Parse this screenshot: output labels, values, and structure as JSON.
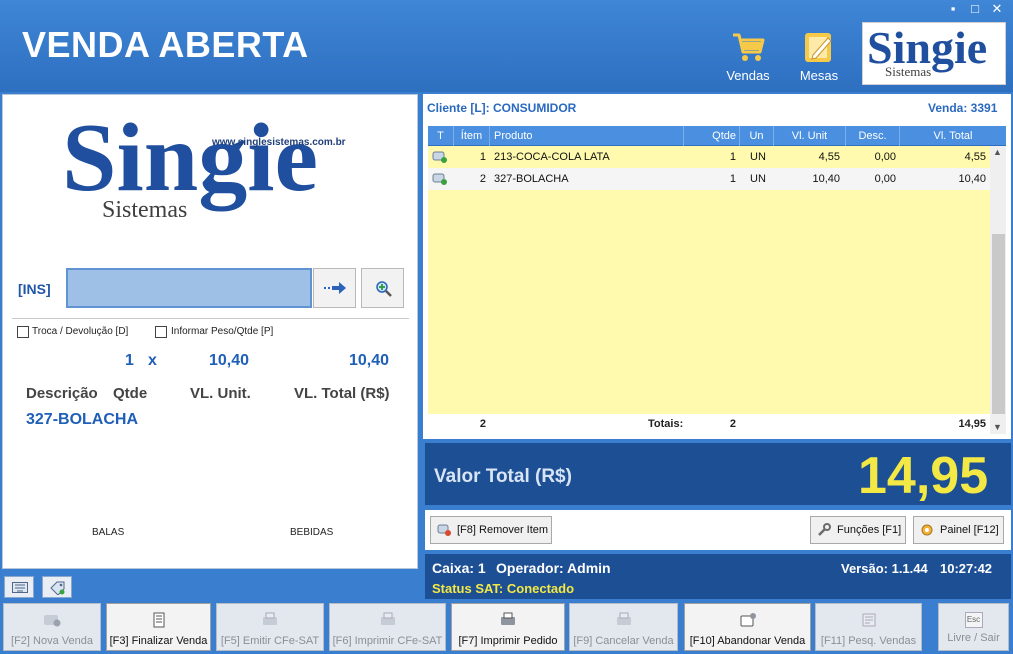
{
  "window": {
    "title": "VENDA ABERTA",
    "controls": [
      "▪",
      "□",
      "✕"
    ]
  },
  "header": {
    "sales_label": "Vendas",
    "tables_label": "Mesas",
    "logo": {
      "word": "Singie",
      "sub": "Sistemas"
    }
  },
  "left": {
    "logo": {
      "word": "Singie",
      "sub": "Sistemas",
      "website": "www.singlesistemas.com.br"
    },
    "ins_label": "[INS]",
    "code_input_value": "",
    "check_return": "Troca / Devolução [D]",
    "check_weight": "Informar Peso/Qtde [P]",
    "current_item": {
      "qty": "1",
      "times": "x",
      "unit": "10,40",
      "total": "10,40",
      "description": "327-BOLACHA"
    },
    "headers": {
      "description": "Descrição",
      "qty": "Qtde",
      "unit": "VL. Unit.",
      "total": "VL. Total (R$)"
    },
    "categories": [
      "BALAS",
      "BEBIDAS"
    ]
  },
  "sale": {
    "client": "Cliente [L]: CONSUMIDOR",
    "number": "Venda:  3391"
  },
  "grid": {
    "columns": [
      "T",
      "Ítem",
      "Produto",
      "Qtde",
      "Un",
      "Vl. Unit",
      "Desc.",
      "Vl. Total"
    ],
    "rows": [
      {
        "item": "1",
        "product": "213-COCA-COLA LATA",
        "qty": "1",
        "unit": "UN",
        "price": "4,55",
        "disc": "0,00",
        "total": "4,55"
      },
      {
        "item": "2",
        "product": "327-BOLACHA",
        "qty": "1",
        "unit": "UN",
        "price": "10,40",
        "disc": "0,00",
        "total": "10,40"
      }
    ],
    "footer": {
      "count": "2",
      "totals_label": "Totais:",
      "qty": "2",
      "total": "14,95"
    }
  },
  "total": {
    "label": "Valor Total (R$)",
    "value": "14,95"
  },
  "actions": {
    "remove": "[F8] Remover Item",
    "functions": "Funções [F1]",
    "panel": "Painel [F12]"
  },
  "status": {
    "cashier": "Caixa: 1",
    "operator": "Operador: Admin",
    "version": "Versão: 1.1.44",
    "time": "10:27:42",
    "sat": "Status SAT: Conectado"
  },
  "bottom": {
    "new_sale": "[F2] Nova Venda",
    "finalize": "[F3] Finalizar Venda",
    "emit": "[F5] Emitir CFe-SAT",
    "print_cfe": "[F6] Imprimir CFe-SAT",
    "print_order": "[F7] Imprimir Pedido",
    "cancel": "[F9] Cancelar Venda",
    "abandon": "[F10] Abandonar Venda",
    "search": "[F11] Pesq. Vendas",
    "exit_key": "Esc",
    "exit": "Livre / Sair"
  },
  "colors": {
    "header_blue": "#3a7fcf",
    "dark_panel": "#1d4f95",
    "total_yellow": "#f4e845",
    "grid_yellow": "#fffaae"
  }
}
